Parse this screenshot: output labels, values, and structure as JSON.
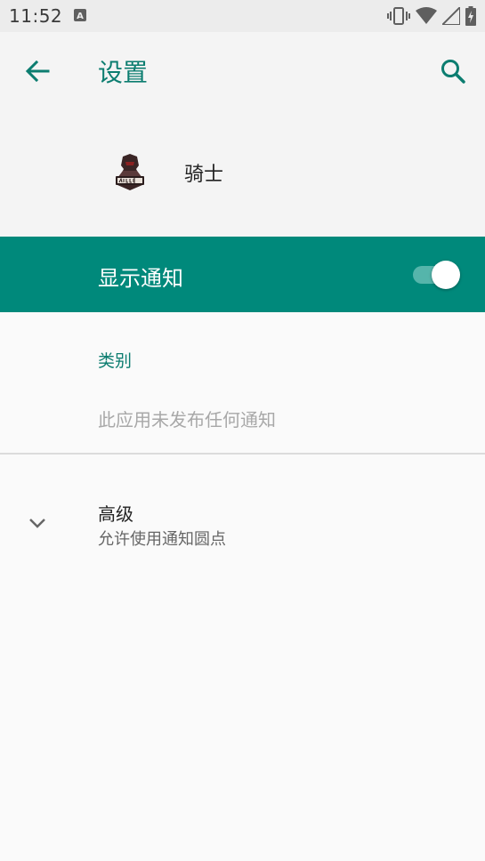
{
  "status_bar": {
    "time": "11:52",
    "icons": [
      "a-notification-icon",
      "vibrate-icon",
      "wifi-icon",
      "signal-icon",
      "battery-icon"
    ]
  },
  "app_bar": {
    "title": "设置",
    "back_icon": "arrow-back-icon",
    "search_icon": "search-icon"
  },
  "app_info": {
    "name": "骑士",
    "icon": "noble-knight-logo"
  },
  "show_notifications": {
    "label": "显示通知",
    "enabled": true
  },
  "category": {
    "header": "类别",
    "empty_text": "此应用未发布任何通知"
  },
  "advanced": {
    "title": "高级",
    "subtitle": "允许使用通知圆点",
    "expand_icon": "chevron-down-icon"
  },
  "colors": {
    "accent": "#0c7d70",
    "banner": "#00897b",
    "toggle_track": "#55b5ab"
  }
}
